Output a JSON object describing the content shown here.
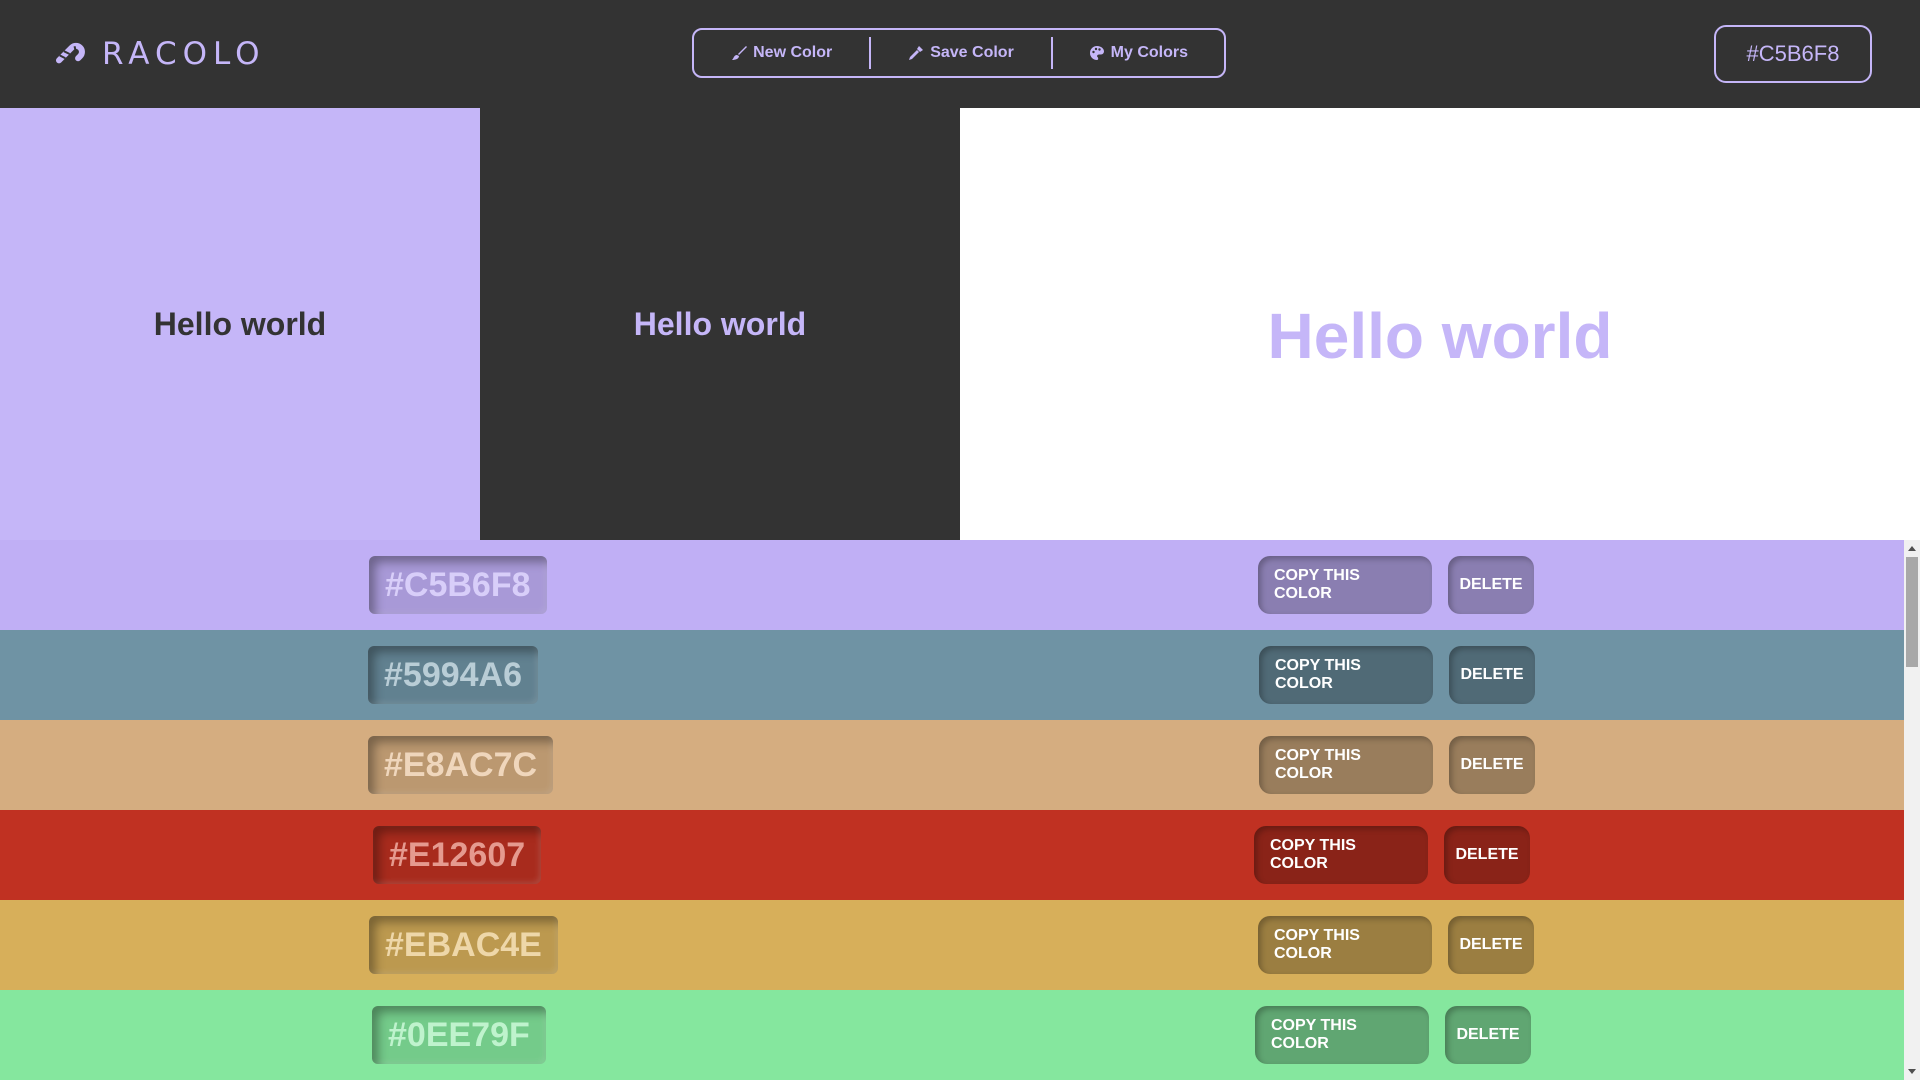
{
  "header": {
    "logo_text": "RACOLO",
    "logo_icon": "candy-cane-icon",
    "nav": [
      {
        "label": "New Color",
        "icon": "paint-brush-icon"
      },
      {
        "label": "Save Color",
        "icon": "eyedropper-icon"
      },
      {
        "label": "My Colors",
        "icon": "palette-icon"
      }
    ],
    "current_hex": "#C5B6F8"
  },
  "preview": {
    "panel_1_text": "Hello world",
    "panel_2_text": "Hello world",
    "panel_3_text": "Hello world"
  },
  "saved_colors": [
    {
      "hex": "#C5B6F8",
      "row_color": "#C0AFF5",
      "hex_text_color": "#D8CEF9",
      "copy_label": "COPY THIS COLOR",
      "delete_label": "DELETE"
    },
    {
      "hex": "#5994A6",
      "row_color": "#6F93A4",
      "hex_text_color": "#B9CDD6",
      "copy_label": "COPY THIS COLOR",
      "delete_label": "DELETE"
    },
    {
      "hex": "#E8AC7C",
      "row_color": "#D5AD80",
      "hex_text_color": "#EFD6BC",
      "copy_label": "COPY THIS COLOR",
      "delete_label": "DELETE"
    },
    {
      "hex": "#E12607",
      "row_color": "#C03122",
      "hex_text_color": "#E59A8F",
      "copy_label": "COPY THIS COLOR",
      "delete_label": "DELETE"
    },
    {
      "hex": "#EBAC4E",
      "row_color": "#D7AF5A",
      "hex_text_color": "#EED7A9",
      "copy_label": "COPY THIS COLOR",
      "delete_label": "DELETE"
    },
    {
      "hex": "#0EE79F",
      "row_color": "#85E79E",
      "hex_text_color": "#BFF3CD",
      "copy_label": "COPY THIS COLOR",
      "delete_label": "DELETE"
    }
  ],
  "colors": {
    "accent": "#C5B6F8",
    "dark": "#333333",
    "white": "#FFFFFF"
  }
}
